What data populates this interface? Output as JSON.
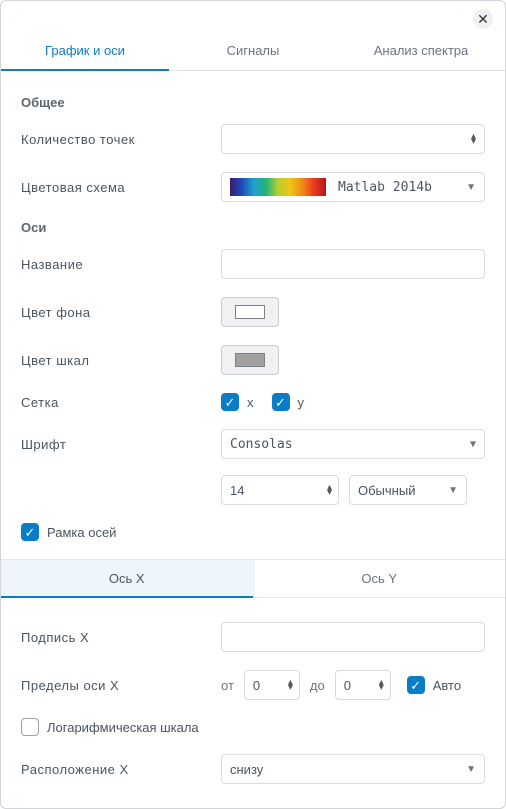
{
  "tabs": {
    "graph_axes": "График и оси",
    "signals": "Сигналы",
    "spectrum": "Анализ спектра"
  },
  "sections": {
    "general": "Общее",
    "axes": "Оси"
  },
  "labels": {
    "num_points": "Количество точек",
    "color_scheme": "Цветовая схема",
    "color_scheme_value": "Matlab 2014b",
    "title": "Название",
    "bg_color": "Цвет фона",
    "scale_color": "Цвет шкал",
    "grid": "Сетка",
    "grid_x": "x",
    "grid_y": "y",
    "font": "Шрифт",
    "font_value": "Consolas",
    "font_size": "14",
    "font_weight": "Обычный",
    "axes_frame": "Рамка осей"
  },
  "colors": {
    "bg": "#ffffff",
    "scale": "#a1a1a1"
  },
  "axis_tabs": {
    "x": "Ось X",
    "y": "Ось Y"
  },
  "axis_x": {
    "label_caption": "Подпись X",
    "limits_caption": "Пределы оси X",
    "from": "от",
    "to": "до",
    "from_val": "0",
    "to_val": "0",
    "auto": "Авто",
    "log_scale": "Логарифмическая шкала",
    "position_caption": "Расположение X",
    "position_value": "снизу"
  }
}
